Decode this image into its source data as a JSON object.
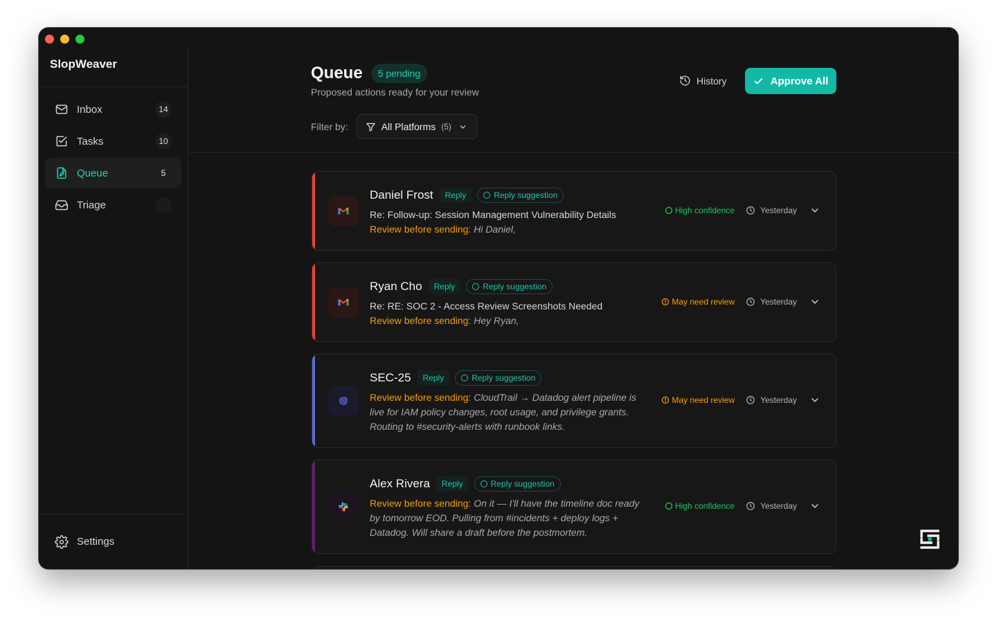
{
  "app": {
    "name": "SlopWeaver",
    "window_controls": [
      "close",
      "minimize",
      "zoom"
    ]
  },
  "sidebar": {
    "items": [
      {
        "label": "Inbox",
        "icon": "mail-icon",
        "count": "14",
        "active": false
      },
      {
        "label": "Tasks",
        "icon": "checkbox-icon",
        "count": "10",
        "active": false
      },
      {
        "label": "Queue",
        "icon": "document-pen-icon",
        "count": "5",
        "active": true
      },
      {
        "label": "Triage",
        "icon": "inbox-tray-icon",
        "count": "",
        "active": false
      }
    ],
    "settings_label": "Settings"
  },
  "header": {
    "title": "Queue",
    "pending_badge": "5 pending",
    "subtitle": "Proposed actions ready for your review",
    "filter_label": "Filter by:",
    "filter_value": "All Platforms",
    "filter_count": "(5)",
    "history_label": "History",
    "approve_label": "Approve All"
  },
  "colors": {
    "accent": "#14b8a6",
    "gmail": "#ea4335",
    "linear": "#5e6ad2",
    "slack": "#611f69",
    "warning": "#f59e0b",
    "success": "#22c55e"
  },
  "cards": [
    {
      "name": "Daniel Frost",
      "tag": "Reply",
      "suggestion": "Reply suggestion",
      "platform": "gmail-icon",
      "subject": "Re: Follow-up: Session Management Vulnerability Details",
      "review_prefix": "Review before sending:",
      "review_text": "Hi Daniel,",
      "confidence": "High confidence",
      "time": "Yesterday"
    },
    {
      "name": "Ryan Cho",
      "tag": "Reply",
      "suggestion": "Reply suggestion",
      "platform": "gmail-icon",
      "subject": "Re: RE: SOC 2 - Access Review Screenshots Needed",
      "review_prefix": "Review before sending:",
      "review_text": "Hey Ryan,",
      "confidence": "May need review",
      "time": "Yesterday"
    },
    {
      "name": "SEC-25",
      "tag": "Reply",
      "suggestion": "Reply suggestion",
      "platform": "linear-icon",
      "subject": "",
      "review_prefix": "Review before sending:",
      "review_text": "CloudTrail → Datadog alert pipeline is live for IAM policy changes, root usage, and privilege grants. Routing to #security-alerts with runbook links.",
      "confidence": "May need review",
      "time": "Yesterday"
    },
    {
      "name": "Alex Rivera",
      "tag": "Reply",
      "suggestion": "Reply suggestion",
      "platform": "slack-icon",
      "subject": "",
      "review_prefix": "Review before sending:",
      "review_text": "On it — I'll have the timeline doc ready by tomorrow EOD. Pulling from #incidents + deploy logs + Datadog. Will share a draft before the postmortem.",
      "confidence": "High confidence",
      "time": "Yesterday"
    }
  ]
}
